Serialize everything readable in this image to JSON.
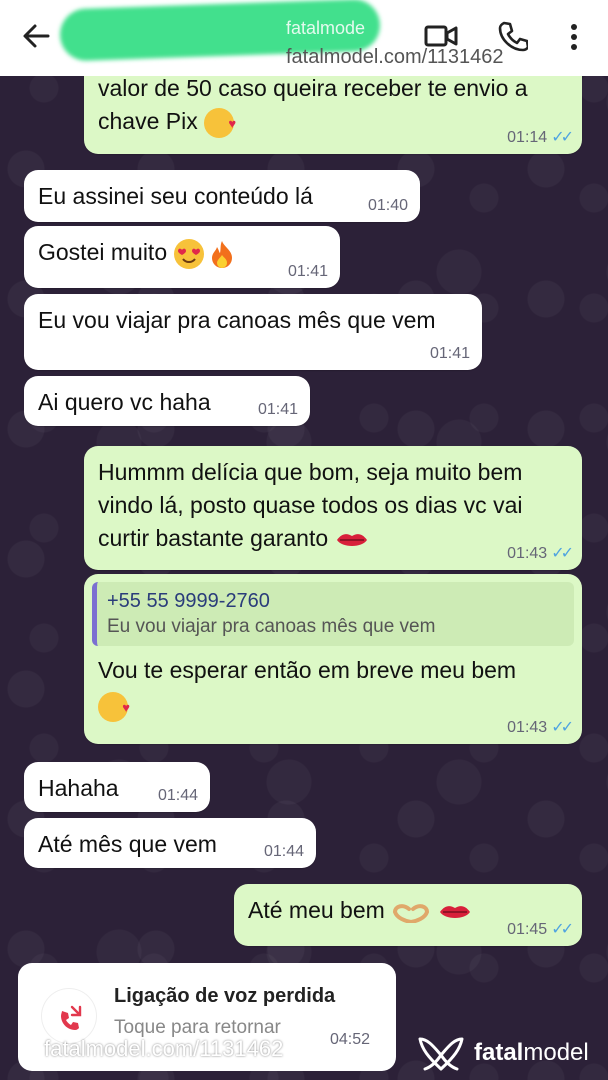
{
  "header": {
    "watermark_small": "fatalmode",
    "watermark_url": "fatalmodel.com/1131462"
  },
  "messages": [
    {
      "text": "valor de 50 caso queira receber te envio a",
      "text2": "chave Pix",
      "time": "01:14",
      "dir": "out"
    },
    {
      "text": "Eu assinei seu conteúdo lá",
      "time": "01:40",
      "dir": "in"
    },
    {
      "text": "Gostei muito",
      "time": "01:41",
      "dir": "in"
    },
    {
      "text": "Eu vou viajar pra canoas mês que vem",
      "time": "01:41",
      "dir": "in"
    },
    {
      "text": "Ai quero vc haha",
      "time": "01:41",
      "dir": "in"
    },
    {
      "text": "Hummm delícia que bom, seja muito bem",
      "text2": "vindo lá, posto quase todos os dias vc vai",
      "text3": "curtir bastante garanto",
      "time": "01:43",
      "dir": "out"
    },
    {
      "reply_name": "+55 55 9999-2760",
      "reply_text": "Eu vou viajar pra canoas mês que vem",
      "text": "Vou te esperar então em breve meu bem",
      "time": "01:43",
      "dir": "out"
    },
    {
      "text": "Hahaha",
      "time": "01:44",
      "dir": "in"
    },
    {
      "text": "Até mês que vem",
      "time": "01:44",
      "dir": "in"
    },
    {
      "text": "Até meu bem",
      "time": "01:45",
      "dir": "out"
    }
  ],
  "missed_call": {
    "title": "Ligação de voz perdida",
    "subtitle": "Toque para retornar",
    "time": "04:52"
  },
  "footer": {
    "watermark_url": "fatalmodel.com/1131462",
    "brand_bold": "fatal",
    "brand_rest": "model"
  },
  "colors": {
    "incoming_bubble": "#ffffff",
    "outgoing_bubble": "#dcf8c6",
    "wallpaper": "#2c2138",
    "read_ticks": "#4fa3e0",
    "redaction": "#42e08d"
  }
}
